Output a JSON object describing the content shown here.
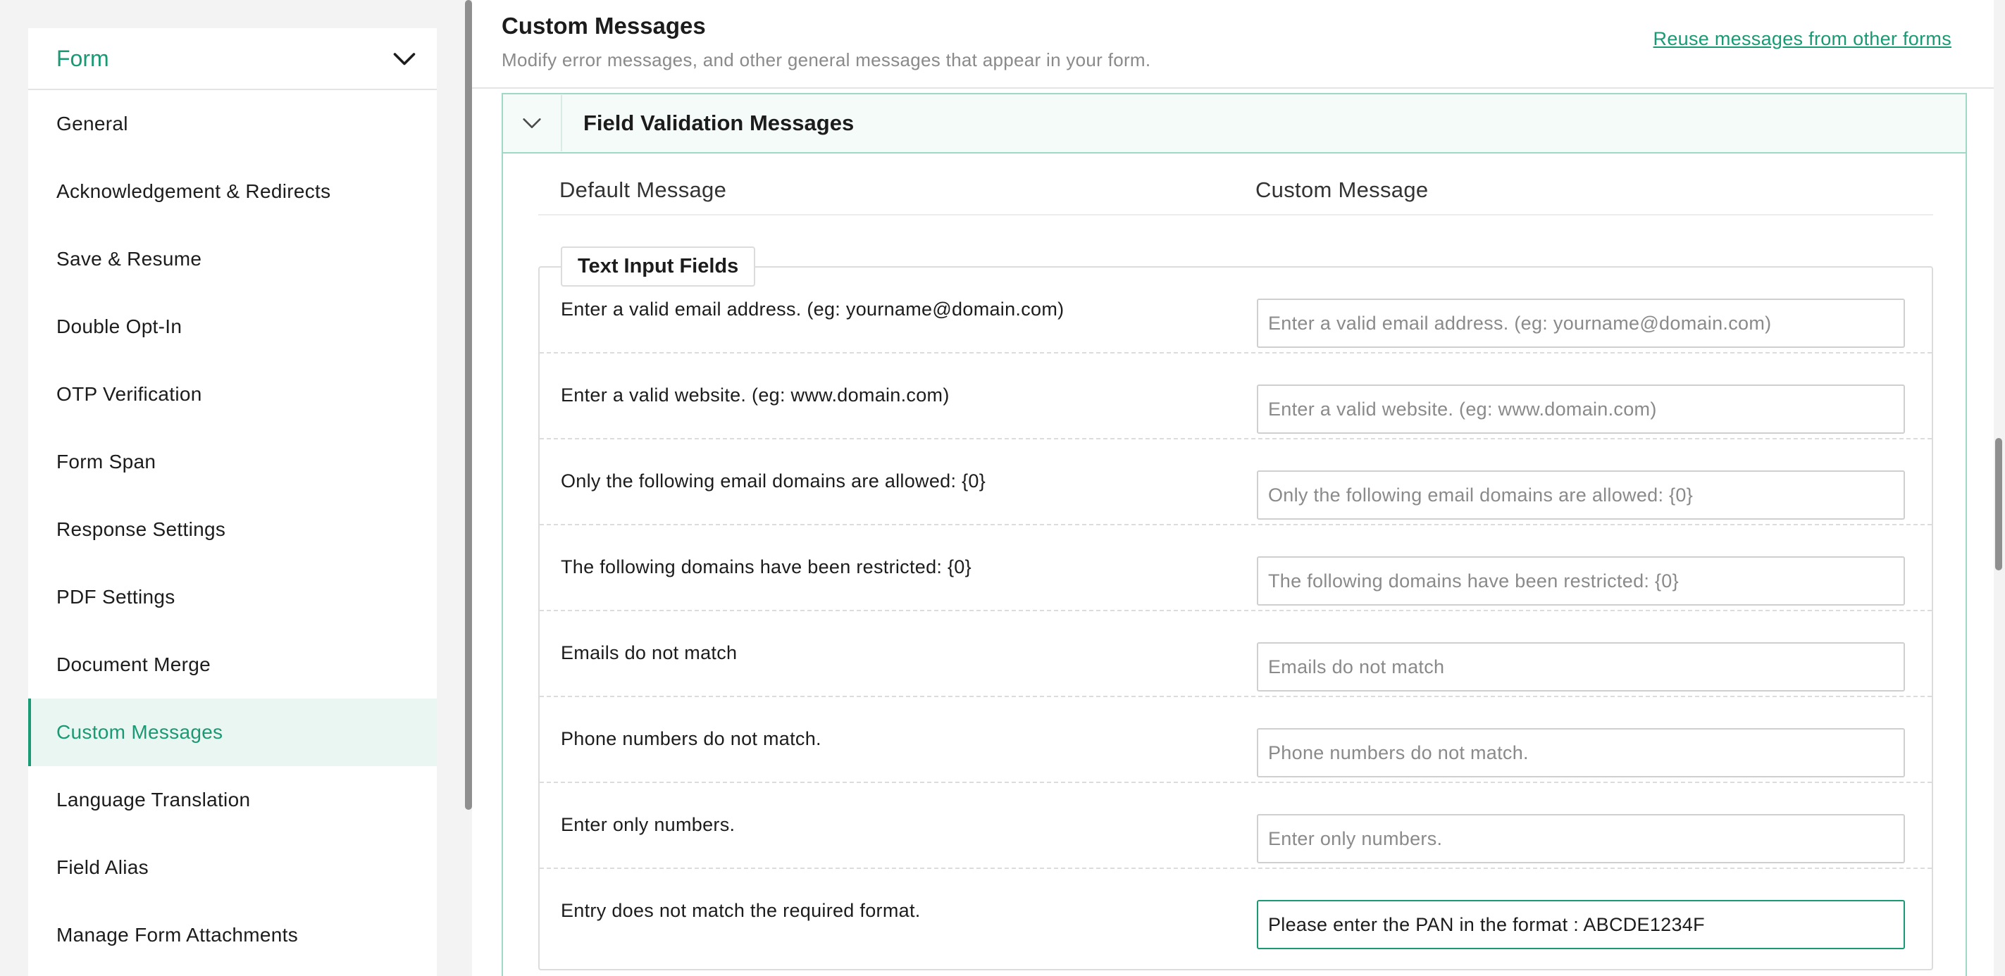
{
  "sidebar": {
    "header": "Form",
    "items": [
      {
        "label": "General"
      },
      {
        "label": "Acknowledgement & Redirects"
      },
      {
        "label": "Save & Resume"
      },
      {
        "label": "Double Opt-In"
      },
      {
        "label": "OTP Verification"
      },
      {
        "label": "Form Span"
      },
      {
        "label": "Response Settings"
      },
      {
        "label": "PDF Settings"
      },
      {
        "label": "Document Merge"
      },
      {
        "label": "Custom Messages"
      },
      {
        "label": "Language Translation"
      },
      {
        "label": "Field Alias"
      },
      {
        "label": "Manage Form Attachments"
      }
    ],
    "active_item": "Custom Messages"
  },
  "main": {
    "title": "Custom Messages",
    "subtitle": "Modify error messages, and other general messages that appear in your form.",
    "reuse_link": "Reuse messages from other forms",
    "section": {
      "title": "Field Validation Messages",
      "col_default": "Default Message",
      "col_custom": "Custom Message",
      "group_title": "Text Input Fields",
      "rows": [
        {
          "default": "Enter a valid email address. (eg: yourname@domain.com)",
          "placeholder": "Enter a valid email address. (eg: yourname@domain.com)",
          "value": ""
        },
        {
          "default": "Enter a valid website. (eg: www.domain.com)",
          "placeholder": "Enter a valid website. (eg: www.domain.com)",
          "value": ""
        },
        {
          "default": "Only the following email domains are allowed: {0}",
          "placeholder": "Only the following email domains are allowed: {0}",
          "value": ""
        },
        {
          "default": "The following domains have been restricted: {0}",
          "placeholder": "The following domains have been restricted: {0}",
          "value": ""
        },
        {
          "default": "Emails do not match",
          "placeholder": "Emails do not match",
          "value": ""
        },
        {
          "default": "Phone numbers do not match.",
          "placeholder": "Phone numbers do not match.",
          "value": ""
        },
        {
          "default": "Enter only numbers.",
          "placeholder": "Enter only numbers.",
          "value": ""
        },
        {
          "default": "Entry does not match the required format.",
          "placeholder": "Entry does not match the required format.",
          "value": "Please enter the PAN in the format : ABCDE1234F"
        }
      ]
    }
  },
  "colors": {
    "accent": "#1a9a74",
    "accent_bg": "#eaf6f1",
    "border_accent": "#9fd8c5"
  },
  "icons": {
    "sidebar_toggle": "chevron-down-icon",
    "section_toggle": "chevron-down-icon"
  }
}
